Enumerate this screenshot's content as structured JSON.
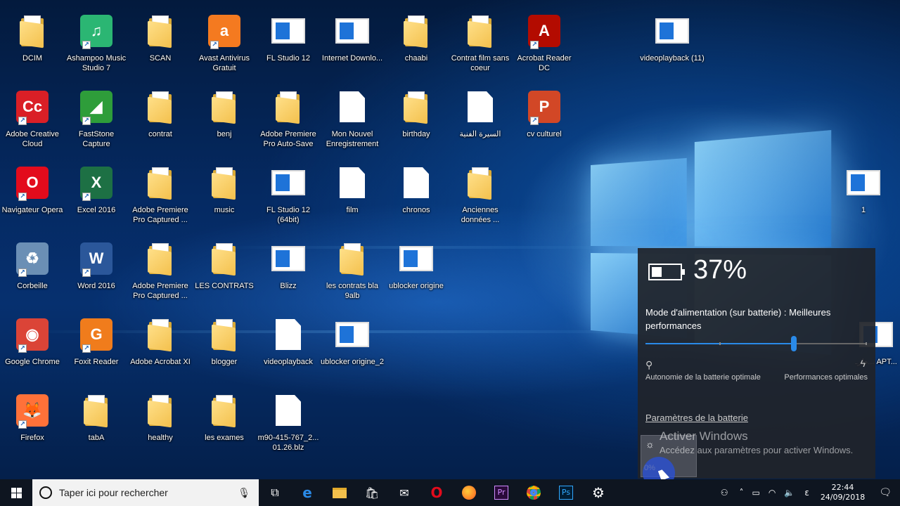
{
  "desktop": {
    "icons": [
      {
        "label": "DCIM",
        "kind": "folder"
      },
      {
        "label": "Ashampoo Music Studio 7",
        "kind": "app",
        "color": "#2bb673",
        "glyph": "♫"
      },
      {
        "label": "SCAN",
        "kind": "folder"
      },
      {
        "label": "Avast Antivirus Gratuit",
        "kind": "app",
        "color": "#f47a20",
        "glyph": "a"
      },
      {
        "label": "FL Studio 12",
        "kind": "screen"
      },
      {
        "label": "Internet Downlo...",
        "kind": "screen"
      },
      {
        "label": "chaabi",
        "kind": "folder"
      },
      {
        "label": "Contrat film sans coeur",
        "kind": "folder"
      },
      {
        "label": "Acrobat Reader DC",
        "kind": "app",
        "color": "#b30b00",
        "glyph": "A"
      },
      {
        "label": "videoplayback (11)",
        "kind": "screen"
      },
      {
        "label": "Adobe Creative Cloud",
        "kind": "app",
        "color": "#da1f26",
        "glyph": "Cc"
      },
      {
        "label": "FastStone Capture",
        "kind": "app",
        "color": "#2e9d3a",
        "glyph": "◢"
      },
      {
        "label": "contrat",
        "kind": "folder"
      },
      {
        "label": "benj",
        "kind": "folder"
      },
      {
        "label": "Adobe Premiere Pro Auto-Save",
        "kind": "folder"
      },
      {
        "label": "Mon Nouvel Enregistrement",
        "kind": "doc"
      },
      {
        "label": "birthday",
        "kind": "folder"
      },
      {
        "label": "السيرة الفنية",
        "kind": "doc"
      },
      {
        "label": "cv culturel",
        "kind": "app",
        "color": "#d24726",
        "glyph": "P"
      },
      {
        "label": "Navigateur Opera",
        "kind": "app",
        "color": "#e30b1c",
        "glyph": "O"
      },
      {
        "label": "Excel 2016",
        "kind": "app",
        "color": "#1d7044",
        "glyph": "X"
      },
      {
        "label": "Adobe Premiere Pro Captured ...",
        "kind": "folder"
      },
      {
        "label": "music",
        "kind": "folder"
      },
      {
        "label": "FL Studio 12 (64bit)",
        "kind": "screen"
      },
      {
        "label": "film",
        "kind": "doc"
      },
      {
        "label": "chronos",
        "kind": "doc"
      },
      {
        "label": "Anciennes données ...",
        "kind": "folder"
      },
      {
        "label": "1",
        "kind": "screen"
      },
      {
        "label": "Corbeille",
        "kind": "app",
        "color": "#6b8fb5",
        "glyph": "♻"
      },
      {
        "label": "Word 2016",
        "kind": "app",
        "color": "#2b579a",
        "glyph": "W"
      },
      {
        "label": "Adobe Premiere Pro Captured ...",
        "kind": "folder"
      },
      {
        "label": "LES CONTRATS",
        "kind": "folder"
      },
      {
        "label": "Blizz",
        "kind": "screen"
      },
      {
        "label": "les contrats bla 9alb",
        "kind": "folder"
      },
      {
        "label": "ublocker origine",
        "kind": "screen"
      },
      {
        "label": "Google Chrome",
        "kind": "app",
        "color": "#db4437",
        "glyph": "◉"
      },
      {
        "label": "Foxit Reader",
        "kind": "app",
        "color": "#f07c1c",
        "glyph": "G"
      },
      {
        "label": "Adobe Acrobat XI",
        "kind": "folder"
      },
      {
        "label": "blogger",
        "kind": "folder"
      },
      {
        "label": "videoplayback",
        "kind": "doc"
      },
      {
        "label": "ublocker origine_2",
        "kind": "screen"
      },
      {
        "label": "طرـ... APT...",
        "kind": "screen"
      },
      {
        "label": "Firefox",
        "kind": "app",
        "color": "#ff7139",
        "glyph": "🦊"
      },
      {
        "label": "tabA",
        "kind": "folder"
      },
      {
        "label": "healthy",
        "kind": "folder"
      },
      {
        "label": "les exames",
        "kind": "folder"
      },
      {
        "label": "m90-415-767_2... 01.26.blz",
        "kind": "doc"
      }
    ]
  },
  "battery_flyout": {
    "percent": "37%",
    "mode_text": "Mode d'alimentation (sur batterie) : Meilleures performances",
    "left_label": "Autonomie de la batterie optimale",
    "right_label": "Performances optimales",
    "slider_value": 0.67,
    "settings_link": "Paramètres de la batterie",
    "brightness_tile_pct": "0%"
  },
  "activation": {
    "title": "Activer Windows",
    "subtitle": "Accédez aux paramètres pour activer Windows."
  },
  "taskbar": {
    "search_placeholder": "Taper ici pour rechercher",
    "apps": [
      "task-view",
      "edge",
      "file-explorer",
      "store",
      "mail",
      "opera",
      "firefox",
      "premiere",
      "chrome",
      "photoshop",
      "settings"
    ],
    "time": "22:44",
    "date": "24/09/2018",
    "ime": "ε"
  },
  "colors": {
    "accent": "#2a8ae8",
    "taskbar": "#0e1520"
  }
}
